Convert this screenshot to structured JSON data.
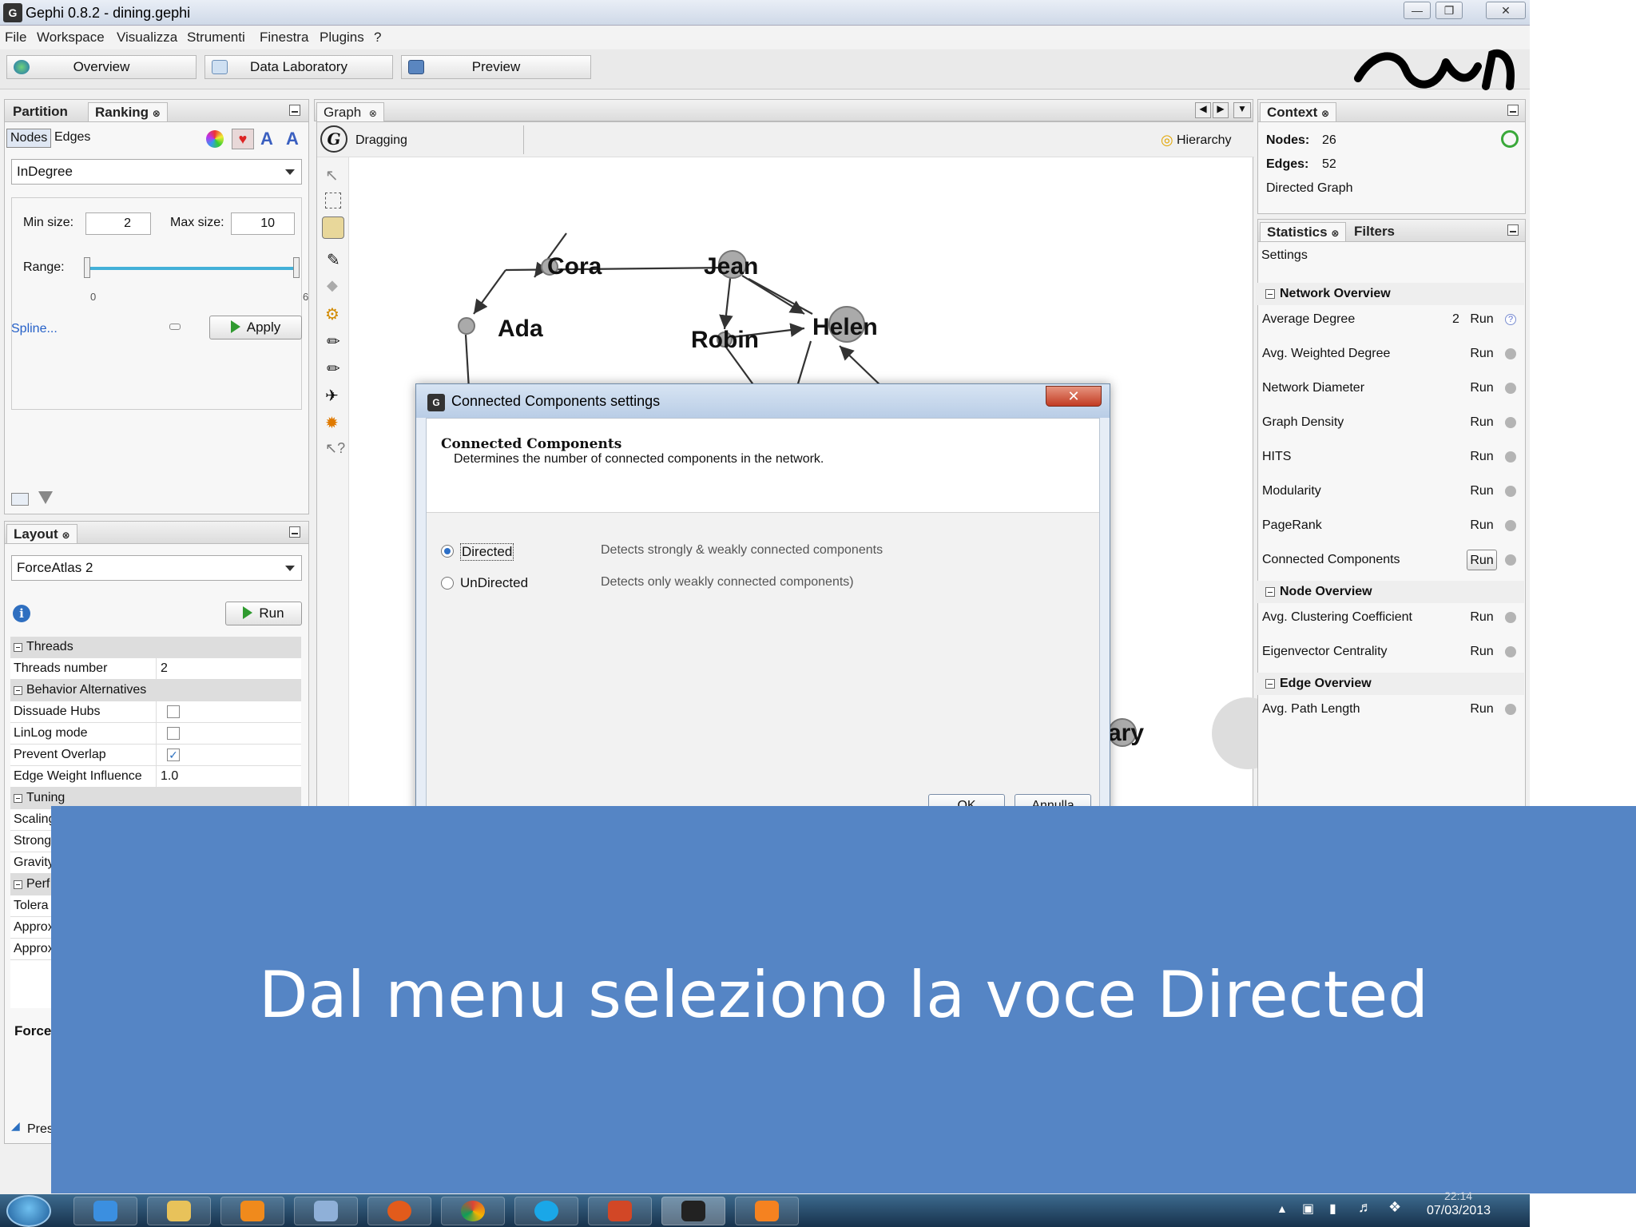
{
  "window": {
    "title": "Gephi 0.8.2 - dining.gephi",
    "app_icon": "gephi-logo-icon",
    "controls": [
      "minimize-icon",
      "restore-icon",
      "close-icon"
    ]
  },
  "menubar": {
    "items": [
      "File",
      "Workspace",
      "Visualizza",
      "Strumenti",
      "Finestra",
      "Plugins",
      "?"
    ]
  },
  "toolbar": {
    "overview": "Overview",
    "data_laboratory": "Data Laboratory",
    "preview": "Preview"
  },
  "left_top_panel": {
    "tabs": [
      "Partition",
      "Ranking"
    ],
    "active_tab": "Ranking",
    "subtabs": [
      "Nodes",
      "Edges"
    ],
    "active_subtab": "Nodes",
    "metric": "InDegree",
    "min_size_label": "Min size:",
    "min_size": "2",
    "max_size_label": "Max size:",
    "max_size": "10",
    "range_label": "Range:",
    "range_min": "0",
    "range_max": "6",
    "spline": "Spline...",
    "apply": "Apply"
  },
  "layout_panel": {
    "tab": "Layout",
    "algorithm": "ForceAtlas 2",
    "run": "Run",
    "sections": {
      "threads": "Threads",
      "behavior": "Behavior Alternatives",
      "tuning": "Tuning",
      "perf": "Perf"
    },
    "rows": {
      "threads_number": {
        "k": "Threads number",
        "v": "2"
      },
      "dissuade_hubs": {
        "k": "Dissuade Hubs",
        "checked": false
      },
      "linlog_mode": {
        "k": "LinLog mode",
        "checked": false
      },
      "prevent_overlap": {
        "k": "Prevent Overlap",
        "checked": true
      },
      "edge_weight_influence": {
        "k": "Edge Weight Influence",
        "v": "1.0"
      },
      "scaling": "Scaling",
      "strong": "Strong",
      "gravity": "Gravity",
      "tolerance": "Tolera",
      "approx1": "Approx",
      "approx2": "Approx"
    },
    "footer_label": "Force",
    "presets": "Pres"
  },
  "graph_panel": {
    "tab": "Graph",
    "mode": "Dragging",
    "hierarchy": "Hierarchy",
    "nodes": [
      "Cora",
      "Jean",
      "Ada",
      "Robin",
      "Helen",
      "ary"
    ]
  },
  "context_panel": {
    "tab": "Context",
    "nodes_label": "Nodes:",
    "nodes": "26",
    "edges_label": "Edges:",
    "edges": "52",
    "graph_type": "Directed Graph"
  },
  "statistics_panel": {
    "tabs": [
      "Statistics",
      "Filters"
    ],
    "settings": "Settings",
    "run_label": "Run",
    "sections": {
      "network": "Network Overview",
      "node": "Node Overview",
      "edge": "Edge Overview"
    },
    "network_rows": [
      {
        "name": "Average Degree",
        "value": "2"
      },
      {
        "name": "Avg. Weighted Degree",
        "value": ""
      },
      {
        "name": "Network Diameter",
        "value": ""
      },
      {
        "name": "Graph Density",
        "value": ""
      },
      {
        "name": "HITS",
        "value": ""
      },
      {
        "name": "Modularity",
        "value": ""
      },
      {
        "name": "PageRank",
        "value": ""
      },
      {
        "name": "Connected Components",
        "value": ""
      }
    ],
    "node_rows": [
      {
        "name": "Avg. Clustering Coefficient"
      },
      {
        "name": "Eigenvector Centrality"
      }
    ],
    "edge_rows": [
      {
        "name": "Avg. Path Length"
      }
    ]
  },
  "dialog": {
    "title": "Connected Components settings",
    "heading": "Connected Components",
    "description": "Determines the number of connected components in the network.",
    "options": [
      {
        "label": "Directed",
        "desc": "Detects strongly & weakly connected components",
        "selected": true
      },
      {
        "label": "UnDirected",
        "desc": "Detects only weakly connected components)",
        "selected": false
      }
    ],
    "ok": "OK",
    "cancel": "Annulla"
  },
  "caption": {
    "text": "Dal menu seleziono la voce Directed"
  },
  "taskbar": {
    "date": "07/03/2013",
    "time": "22:14"
  },
  "colors": {
    "caption_bg": "#5585c5",
    "caption_text": "#ffffff",
    "selection": "#2c6fc7",
    "play_green": "#2f9a2f"
  }
}
